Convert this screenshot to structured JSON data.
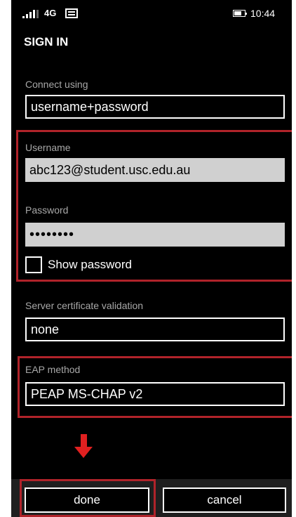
{
  "status_bar": {
    "network": "4G",
    "time": "10:44",
    "signal_icon": "signal-bars-icon",
    "message_icon": "message-icon",
    "battery_icon": "battery-icon"
  },
  "page": {
    "title": "SIGN IN"
  },
  "form": {
    "connect_using": {
      "label": "Connect using",
      "value": "username+password"
    },
    "username": {
      "label": "Username",
      "value": "abc123@student.usc.edu.au"
    },
    "password": {
      "label": "Password",
      "value": "••••••••"
    },
    "show_password": {
      "label": "Show password",
      "checked": false
    },
    "server_cert": {
      "label": "Server certificate validation",
      "value": "none"
    },
    "eap_method": {
      "label": "EAP method",
      "value": "PEAP MS-CHAP v2"
    }
  },
  "buttons": {
    "done": "done",
    "cancel": "cancel"
  },
  "colors": {
    "highlight": "#b0232a",
    "arrow": "#e02020"
  }
}
